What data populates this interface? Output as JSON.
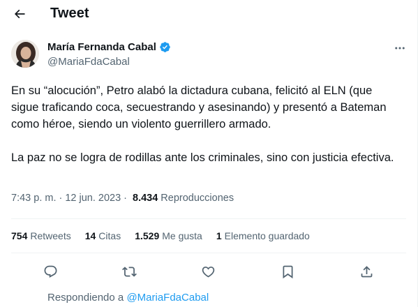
{
  "header": {
    "title": "Tweet"
  },
  "author": {
    "name": "María Fernanda Cabal",
    "handle": "@MariaFdaCabal",
    "verified": true
  },
  "tweet": {
    "paragraph1": "En su “alocución”, Petro alabó la dictadura cubana, felicitó al ELN (que sigue traficando coca, secuestrando y asesinando) y presentó a Bateman como héroe, siendo un violento guerrillero armado.",
    "paragraph2": "La paz no se logra de rodillas ante los criminales, sino con justicia efectiva."
  },
  "meta": {
    "time": "7:43 p. m.",
    "separator": "·",
    "date": "12 jun. 2023",
    "views_count": "8.434",
    "views_label": "Reproducciones"
  },
  "stats": {
    "retweets_count": "754",
    "retweets_label": "Retweets",
    "quotes_count": "14",
    "quotes_label": "Citas",
    "likes_count": "1.529",
    "likes_label": "Me gusta",
    "bookmarks_count": "1",
    "bookmarks_label": "Elemento guardado"
  },
  "actions": {
    "icons": [
      "reply-icon",
      "retweet-icon",
      "like-icon",
      "bookmark-icon",
      "share-icon"
    ]
  },
  "reply": {
    "prefix": "Respondiendo a",
    "mention": "@MariaFdaCabal"
  },
  "colors": {
    "accent": "#1d9bf0",
    "text": "#0f1419",
    "secondary": "#536471",
    "divider": "#eff3f4"
  }
}
